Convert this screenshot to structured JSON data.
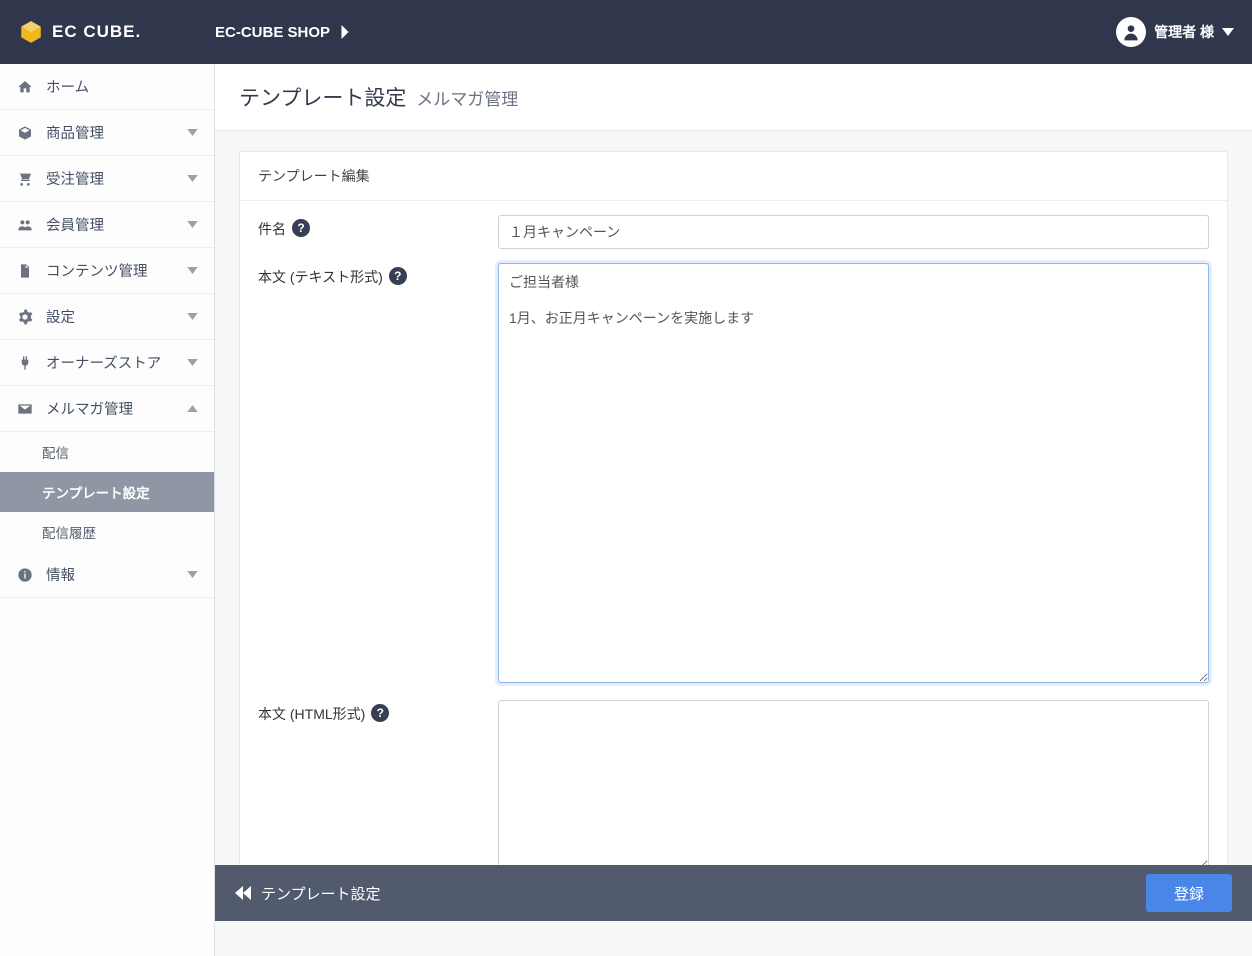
{
  "header": {
    "brand": "EC CUBE.",
    "shop_name": "EC-CUBE SHOP",
    "user_label": "管理者 様"
  },
  "sidebar": {
    "home": "ホーム",
    "product": "商品管理",
    "order": "受注管理",
    "member": "会員管理",
    "content": "コンテンツ管理",
    "setting": "設定",
    "owner_store": "オーナーズストア",
    "mailmag": "メルマガ管理",
    "mailmag_sub": {
      "send": "配信",
      "template": "テンプレート設定",
      "history": "配信履歴"
    },
    "info": "情報"
  },
  "page": {
    "title_main": "テンプレート設定",
    "title_sub": "メルマガ管理",
    "card_header": "テンプレート編集",
    "label_subject": "件名",
    "label_body_text": "本文 (テキスト形式)",
    "label_body_html": "本文 (HTML形式)",
    "subject_value": "１月キャンペーン",
    "body_text_value": "ご担当者様\n\n1月、お正月キャンペーンを実施します"
  },
  "footer": {
    "back_label": "テンプレート設定",
    "submit_label": "登録"
  }
}
